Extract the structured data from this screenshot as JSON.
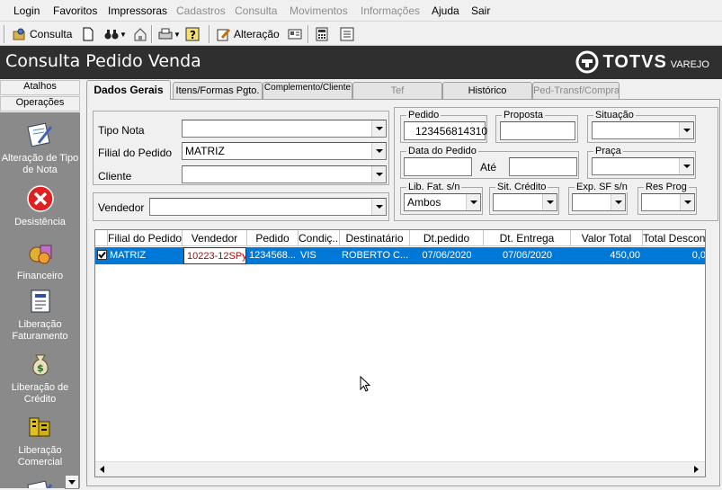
{
  "menu": {
    "items": [
      {
        "label": "Login",
        "enabled": true
      },
      {
        "label": "Favoritos",
        "enabled": true
      },
      {
        "label": "Impressoras",
        "enabled": true
      },
      {
        "label": "Cadastros",
        "enabled": false
      },
      {
        "label": "Consulta",
        "enabled": false
      },
      {
        "label": "Movimentos",
        "enabled": false
      },
      {
        "label": "Informações",
        "enabled": false
      },
      {
        "label": "Ajuda",
        "enabled": true
      },
      {
        "label": "Sair",
        "enabled": true
      }
    ]
  },
  "toolbar": {
    "consulta_label": "Consulta",
    "alteracao_label": "Alteração",
    "icons": [
      "consulta-icon",
      "new-document-icon",
      "binoculars-icon",
      "home-icon",
      "printer-icon",
      "help-icon",
      "alteracao-icon",
      "card-icon",
      "calculator-icon",
      "list-icon"
    ]
  },
  "header": {
    "title": "Consulta Pedido Venda",
    "logo_text": "TOTVS",
    "logo_sub": "VAREJO",
    "background": "#2f2f2f"
  },
  "sidebar": {
    "atalhos_label": "Atalhos",
    "operacoes_label": "Operações",
    "items": [
      {
        "label": "Alteração de Tipo de Nota",
        "icon": "edit-note-icon"
      },
      {
        "label": "Desistência",
        "icon": "cancel-icon"
      },
      {
        "label": "Financeiro",
        "icon": "financial-icon"
      },
      {
        "label": "Liberação Faturamento",
        "icon": "billing-release-icon"
      },
      {
        "label": "Liberação de Crédito",
        "icon": "money-bag-icon"
      },
      {
        "label": "Liberação Comercial",
        "icon": "commercial-release-icon"
      }
    ]
  },
  "tabs": [
    {
      "label": "Dados Gerais",
      "active": true,
      "enabled": true
    },
    {
      "label": "Itens/Formas Pgto.",
      "active": false,
      "enabled": true
    },
    {
      "label": "Complemento/Cliente",
      "active": false,
      "enabled": true
    },
    {
      "label": "Tef",
      "active": false,
      "enabled": false
    },
    {
      "label": "Histórico",
      "active": false,
      "enabled": true
    },
    {
      "label": "Ped-Transf/Compra",
      "active": false,
      "enabled": false
    }
  ],
  "form": {
    "tipo_nota_label": "Tipo Nota",
    "tipo_nota_value": "",
    "filial_label": "Filial do Pedido",
    "filial_value": "MATRIZ",
    "cliente_label": "Cliente",
    "cliente_value": "",
    "vendedor_label": "Vendedor",
    "vendedor_value": "",
    "pedido_label": "Pedido",
    "pedido_value": "123456814310",
    "proposta_label": "Proposta",
    "proposta_value": "",
    "situacao_label": "Situação",
    "situacao_value": "",
    "data_pedido_label": "Data do Pedido",
    "data_pedido_value": "",
    "ate_label": "Até",
    "ate_value": "",
    "praca_label": "Praça",
    "praca_value": "",
    "lib_fat_label": "Lib. Fat. s/n",
    "lib_fat_value": "Ambos",
    "sit_credito_label": "Sit. Crédito",
    "sit_credito_value": "",
    "exp_sf_label": "Exp. SF s/n",
    "exp_sf_value": "",
    "res_prog_label": "Res Prog",
    "res_prog_value": ""
  },
  "grid": {
    "columns": [
      "Filial do Pedido",
      "Vendedor",
      "Pedido",
      "Condiç...",
      "Destinatário",
      "Dt.pedido",
      "Dt. Entrega",
      "Valor Total",
      "Total Desconto"
    ],
    "rows": [
      {
        "checked": true,
        "cells": [
          "MATRIZ",
          "10223-12SPy",
          "1234568...",
          "VIS",
          "ROBERTO C...",
          "07/06/2020",
          "07/06/2020",
          "450,00",
          "0,0"
        ]
      }
    ],
    "selection_color": "#0078d7"
  }
}
